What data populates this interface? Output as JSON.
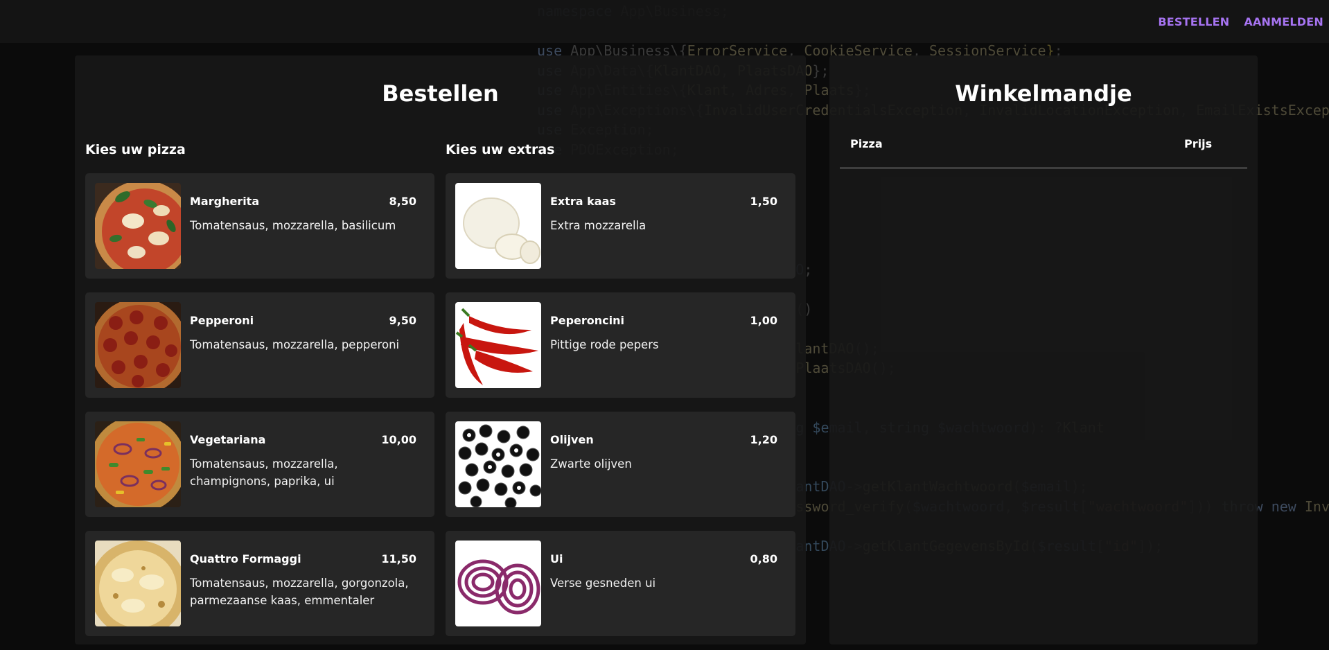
{
  "nav": {
    "bestellen": "BESTELLEN",
    "aanmelden": "AANMELDEN",
    "accent": "#a774f2"
  },
  "order": {
    "title": "Bestellen",
    "pizza_heading": "Kies uw pizza",
    "extras_heading": "Kies uw extras",
    "pizzas": [
      {
        "name": "Margherita",
        "price": "8,50",
        "desc": "Tomatensaus, mozzarella, basilicum",
        "image": "margherita-pizza-photo"
      },
      {
        "name": "Pepperoni",
        "price": "9,50",
        "desc": "Tomatensaus, mozzarella, pepperoni",
        "image": "pepperoni-pizza-photo"
      },
      {
        "name": "Vegetariana",
        "price": "10,00",
        "desc": "Tomatensaus, mozzarella, champignons, paprika, ui",
        "image": "vegetariana-pizza-photo"
      },
      {
        "name": "Quattro Formaggi",
        "price": "11,50",
        "desc": "Tomatensaus, mozzarella, gorgonzola, parmezaanse kaas, emmentaler",
        "image": "quattro-formaggi-pizza-photo"
      }
    ],
    "extras": [
      {
        "name": "Extra kaas",
        "price": "1,50",
        "desc": "Extra mozzarella",
        "image": "mozzarella-photo"
      },
      {
        "name": "Peperoncini",
        "price": "1,00",
        "desc": "Pittige rode pepers",
        "image": "red-peppers-photo"
      },
      {
        "name": "Olijven",
        "price": "1,20",
        "desc": "Zwarte olijven",
        "image": "black-olives-photo"
      },
      {
        "name": "Ui",
        "price": "0,80",
        "desc": "Verse gesneden ui",
        "image": "red-onion-photo"
      }
    ]
  },
  "cart": {
    "title": "Winkelmandje",
    "col_pizza": "Pizza",
    "col_prijs": "Prijs"
  }
}
